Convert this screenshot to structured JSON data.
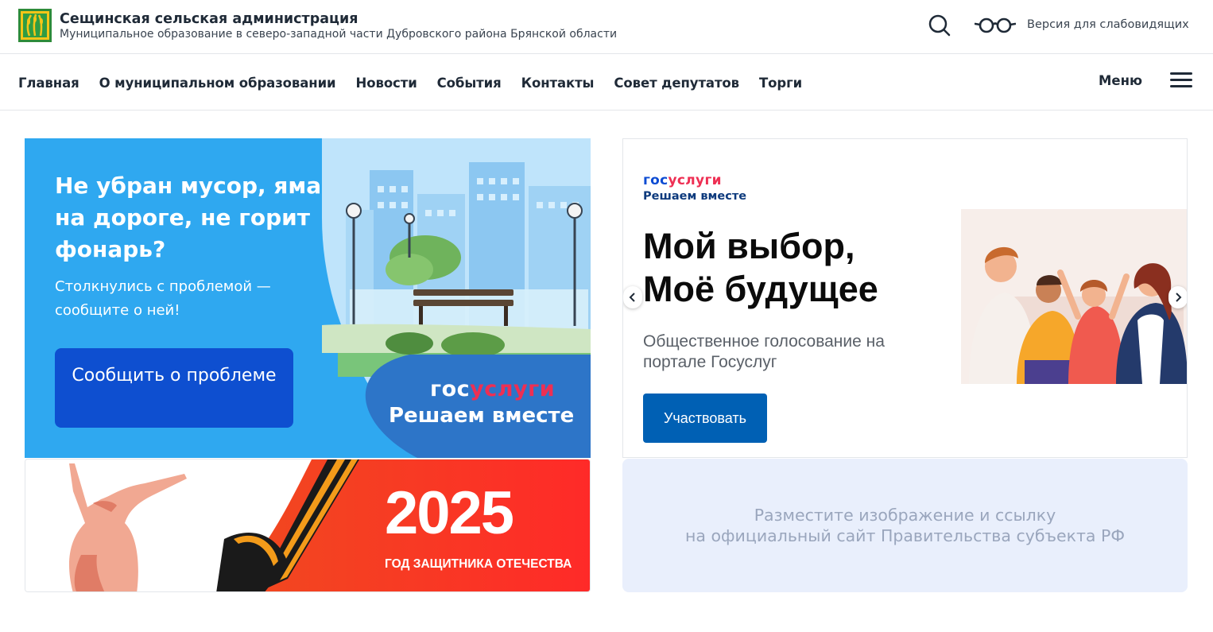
{
  "header": {
    "title": "Сещинская сельская администрация",
    "subtitle": "Муниципальное образование в северо-западной части Дубровского района Брянской области",
    "a11y_label": "Версия для слабовидящих",
    "icons": [
      "coat-of-arms-logo",
      "search-icon",
      "glasses-icon"
    ]
  },
  "nav": {
    "items": [
      {
        "label": "Главная"
      },
      {
        "label": "О муниципальном образовании"
      },
      {
        "label": "Новости"
      },
      {
        "label": "События"
      },
      {
        "label": "Контакты"
      },
      {
        "label": "Совет депутатов"
      },
      {
        "label": "Торги"
      }
    ],
    "menu_label": "Меню"
  },
  "banner_problem": {
    "title": "Не убран мусор, яма на дороге, не горит фонарь?",
    "subtitle": "Столкнулись с проблемой — сообщите о ней!",
    "button": "Сообщить о проблеме",
    "logo_part1": "гос",
    "logo_part2": "услуги",
    "slogan": "Решаем вместе",
    "colors": {
      "background": "#2fa8f0",
      "button": "#0e4fd0",
      "bottom_panel": "#2d75c8"
    }
  },
  "banner_vote": {
    "logo_part1": "гос",
    "logo_part2": "услуги",
    "logo_sub": "Решаем вместе",
    "title_line1": "Мой выбор,",
    "title_line2": "Моё будущее",
    "description": "Общественное голосование на портале Госуслуг",
    "button": "Участвовать",
    "colors": {
      "button": "#0060b4",
      "logo_blue": "#0d4cd3",
      "logo_red": "#ee2f53"
    }
  },
  "banner_2025": {
    "year": "2025",
    "caption": "ГОД ЗАЩИТНИКА ОТЕЧЕСТВА",
    "colors": {
      "background_start": "#f04a1f",
      "background_end": "#ff2a28"
    }
  },
  "banner_placeholder": {
    "line1": "Разместите изображение и ссылку",
    "line2": "на официальный сайт Правительства субъекта РФ"
  }
}
